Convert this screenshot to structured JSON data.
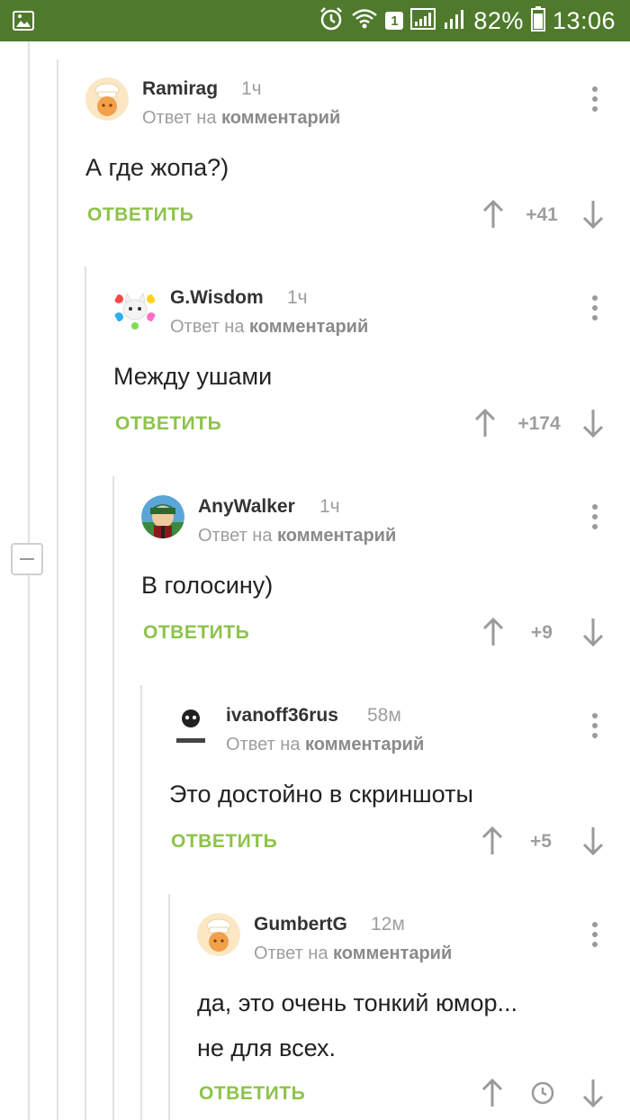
{
  "status_bar": {
    "battery": "82%",
    "time": "13:06",
    "sim_slot": "1"
  },
  "reply_label": "ОТВЕТИТЬ",
  "comments": [
    {
      "author": "Ramirag",
      "time": "1ч",
      "reply_prefix": "Ответ на ",
      "reply_target": "комментарий",
      "text": "А где жопа?)",
      "rating": "+41"
    },
    {
      "author": "G.Wisdom",
      "time": "1ч",
      "reply_prefix": "Ответ на ",
      "reply_target": "комментарий",
      "text": "Между ушами",
      "rating": "+174"
    },
    {
      "author": "AnyWalker",
      "time": "1ч",
      "reply_prefix": "Ответ на ",
      "reply_target": "комментарий",
      "text": "В голосину)",
      "rating": "+9"
    },
    {
      "author": "ivanoff36rus",
      "time": "58м",
      "reply_prefix": "Ответ на ",
      "reply_target": "комментарий",
      "text": "Это достойно в скриншоты",
      "rating": "+5"
    },
    {
      "author": "GumbertG",
      "time": "12м",
      "reply_prefix": "Ответ на ",
      "reply_target": "комментарий",
      "text_line1": "да, это очень тонкий юмор...",
      "text_line2": "не для всех.",
      "rating_icon": "clock-icon"
    }
  ],
  "colors": {
    "status_bar": "#4f7a2c",
    "reply_green": "#8dc34a",
    "muted": "#9e9e9e"
  }
}
